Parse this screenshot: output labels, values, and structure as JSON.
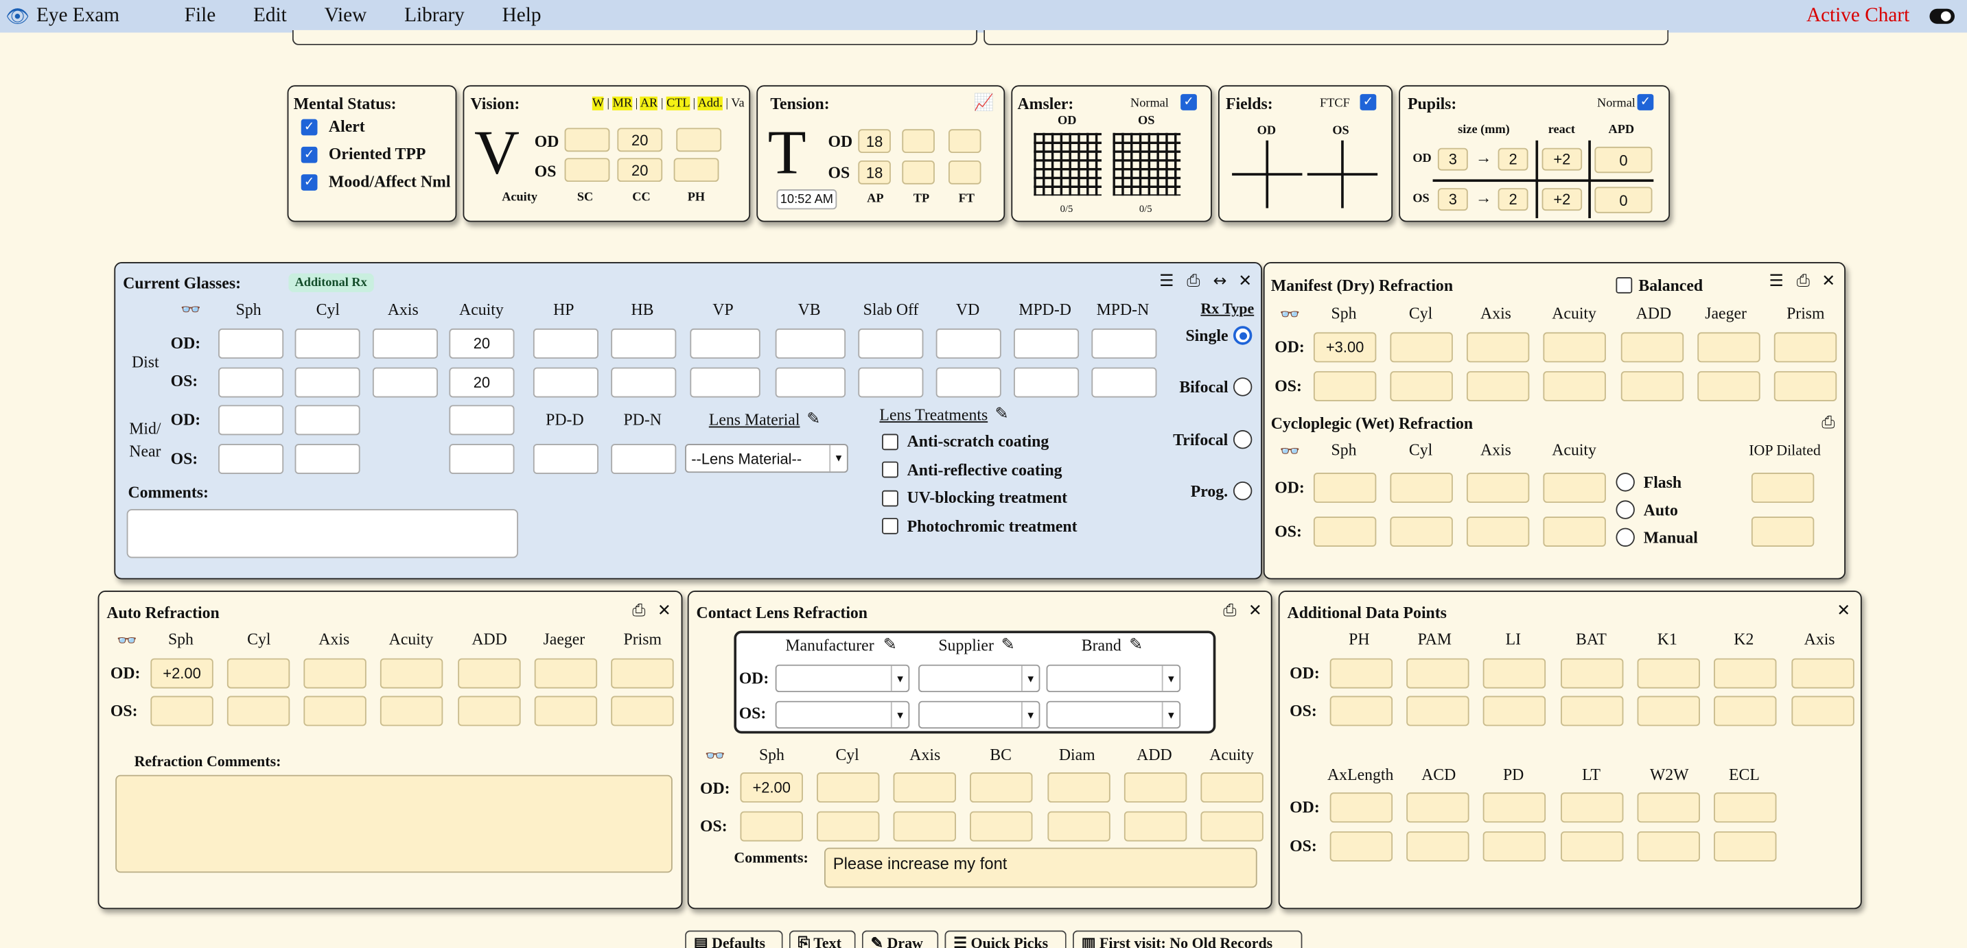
{
  "menu": {
    "app": "Eye Exam",
    "items": [
      "File",
      "Edit",
      "View",
      "Library",
      "Help"
    ],
    "active_chart": "Active Chart"
  },
  "mental": {
    "title": "Mental Status:",
    "items": [
      "Alert",
      "Oriented TPP",
      "Mood/Affect Nml"
    ]
  },
  "vision": {
    "title": "Vision:",
    "tags": [
      "W",
      "MR",
      "AR",
      "CTL",
      "Add.",
      "Va"
    ],
    "letter": "V",
    "od": "OD",
    "os": "OS",
    "od_cc": "20",
    "os_cc": "20",
    "cols": [
      "Acuity",
      "SC",
      "CC",
      "PH"
    ]
  },
  "tension": {
    "title": "Tension:",
    "letter": "T",
    "od": "OD",
    "os": "OS",
    "od_ap": "18",
    "os_ap": "18",
    "time": "10:52 AM",
    "cols": [
      "AP",
      "TP",
      "FT"
    ]
  },
  "amsler": {
    "title": "Amsler:",
    "normal": "Normal",
    "od": "OD",
    "os": "OS",
    "od_score": "0/5",
    "os_score": "0/5"
  },
  "fields": {
    "title": "Fields:",
    "ftcf": "FTCF",
    "od": "OD",
    "os": "OS"
  },
  "pupils": {
    "title": "Pupils:",
    "normal": "Normal",
    "size": "size (mm)",
    "react": "react",
    "apd": "APD",
    "od": "OD",
    "os": "OS",
    "arrow": "→",
    "od_v": [
      "3",
      "2",
      "+2",
      "0"
    ],
    "os_v": [
      "3",
      "2",
      "+2",
      "0"
    ]
  },
  "glasses": {
    "title": "Current Glasses:",
    "badge": "Additonal Rx",
    "cols": [
      "Sph",
      "Cyl",
      "Axis",
      "Acuity",
      "HP",
      "HB",
      "VP",
      "VB",
      "Slab Off",
      "VD",
      "MPD-D",
      "MPD-N"
    ],
    "dist": "Dist",
    "midnear": "Mid/",
    "near": "Near",
    "od": "OD:",
    "os": "OS:",
    "od_acuity": "20",
    "os_acuity": "20",
    "pd_d": "PD-D",
    "pd_n": "PD-N",
    "lens_material": "Lens Material",
    "lens_select": "--Lens Material--",
    "lens_treatments": "Lens Treatments",
    "treatments": [
      "Anti-scratch coating",
      "Anti-reflective coating",
      "UV-blocking treatment",
      "Photochromic treatment"
    ],
    "comments": "Comments:",
    "rx_type": "Rx Type",
    "rx_options": [
      "Single",
      "Bifocal",
      "Trifocal",
      "Prog."
    ]
  },
  "manifest": {
    "title": "Manifest (Dry) Refraction",
    "balanced": "Balanced",
    "cols": [
      "Sph",
      "Cyl",
      "Axis",
      "Acuity",
      "ADD",
      "Jaeger",
      "Prism"
    ],
    "od": "OD:",
    "os": "OS:",
    "od_sph": "+3.00"
  },
  "cyclo": {
    "title": "Cycloplegic (Wet) Refraction",
    "cols": [
      "Sph",
      "Cyl",
      "Axis",
      "Acuity"
    ],
    "iop": "IOP Dilated",
    "od": "OD:",
    "os": "OS:",
    "options": [
      "Flash",
      "Auto",
      "Manual"
    ]
  },
  "auto": {
    "title": "Auto Refraction",
    "cols": [
      "Sph",
      "Cyl",
      "Axis",
      "Acuity",
      "ADD",
      "Jaeger",
      "Prism"
    ],
    "od": "OD:",
    "os": "OS:",
    "od_sph": "+2.00",
    "comments": "Refraction Comments:"
  },
  "contact": {
    "title": "Contact Lens Refraction",
    "heads": [
      "Manufacturer",
      "Supplier",
      "Brand"
    ],
    "od": "OD:",
    "os": "OS:",
    "cols": [
      "Sph",
      "Cyl",
      "Axis",
      "BC",
      "Diam",
      "ADD",
      "Acuity"
    ],
    "od_sph": "+2.00",
    "comments": "Comments:",
    "comment_text": "Please increase my font"
  },
  "adp": {
    "title": "Additional Data Points",
    "cols1": [
      "PH",
      "PAM",
      "LI",
      "BAT",
      "K1",
      "K2",
      "Axis"
    ],
    "cols2": [
      "AxLength",
      "ACD",
      "PD",
      "LT",
      "W2W",
      "ECL"
    ],
    "od": "OD:",
    "os": "OS:"
  },
  "tabs": [
    "Defaults",
    "Text",
    "Draw",
    "Quick Picks",
    "First visit: No Old Records"
  ],
  "colors": {
    "menubar": "#c9d9ee",
    "background": "#fdf8e6",
    "input": "#fdf0c9",
    "active": "#d80000",
    "check": "#1f64d8"
  }
}
